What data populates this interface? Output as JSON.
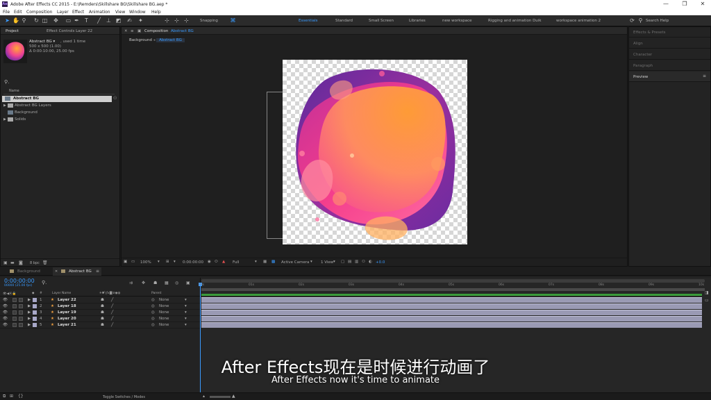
{
  "app": {
    "title": "Adobe After Effects CC 2015 - E:\\Remders\\Skillshare BG\\Skillshare BG.aep *",
    "logo": "Ae"
  },
  "window": {
    "minimize": "—",
    "maximize": "❐",
    "close": "✕"
  },
  "menu": [
    "File",
    "Edit",
    "Composition",
    "Layer",
    "Effect",
    "Animation",
    "View",
    "Window",
    "Help"
  ],
  "toolbar": {
    "snapping": "Snapping",
    "search_help": "Search Help",
    "workspaces": [
      "Essentials",
      "Standard",
      "Small Screen",
      "Libraries",
      "new workspace",
      "Rigging and animation Duik",
      "workspace animation 2"
    ]
  },
  "project": {
    "tab": "Project",
    "effect_controls_tab": "Effect Controls Layer 22",
    "item_name": "Abstract BG ▾",
    "item_used": ", used 1 time",
    "item_size": "500 x 500 (1.00)",
    "item_duration": "Δ 0:00:10:00, 25.00 fps",
    "col_name": "Name",
    "items": [
      "Abstract BG",
      "Abstract BG Layers",
      "Background",
      "Solids"
    ],
    "bpc": "8 bpc"
  },
  "composition": {
    "tab": "Composition",
    "tab_name": "Abstract BG",
    "breadcrumbs": [
      "Background",
      "Abstract BG"
    ],
    "zoom": "100%",
    "timecode": "0:00:00:00",
    "resolution": "Full",
    "camera": "Active Camera",
    "view": "1 View",
    "exposure": "+0.0"
  },
  "right_panels": [
    "Effects & Presets",
    "Align",
    "Character",
    "Paragraph",
    "Preview"
  ],
  "timeline": {
    "tabs": [
      "Background",
      "Abstract BG"
    ],
    "timecode": "0:00:00:00",
    "fps": "00000 (25.00 fps)",
    "col_layer_name": "Layer Name",
    "col_parent": "Parent",
    "ticks": [
      "00s",
      "01s",
      "02s",
      "03s",
      "04s",
      "05s",
      "06s",
      "07s",
      "08s",
      "09s",
      "10s"
    ],
    "toggle": "Toggle Switches / Modes",
    "layers": [
      {
        "num": "1",
        "name": "Layer 22",
        "parent": "None"
      },
      {
        "num": "2",
        "name": "Layer 18",
        "parent": "None"
      },
      {
        "num": "3",
        "name": "Layer 19",
        "parent": "None"
      },
      {
        "num": "4",
        "name": "Layer 20",
        "parent": "None"
      },
      {
        "num": "5",
        "name": "Layer 21",
        "parent": "None"
      }
    ]
  },
  "subtitle": {
    "zh": "After Effects现在是时候进行动画了",
    "en": "After Effects now it's time to animate"
  },
  "colors": {
    "accent": "#2d8ceb",
    "blob_orange": "#ffa735",
    "blob_pink": "#f23c96",
    "blob_purple": "#7a2fa0"
  }
}
